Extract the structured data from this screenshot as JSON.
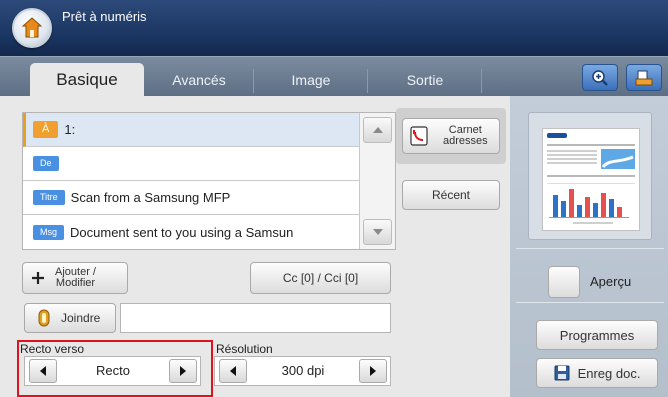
{
  "window": {
    "title": "Prêt à numéris"
  },
  "tabs": [
    {
      "label": "Basique",
      "active": true
    },
    {
      "label": "Avancés",
      "active": false
    },
    {
      "label": "Image",
      "active": false
    },
    {
      "label": "Sortie",
      "active": false
    }
  ],
  "toolbar": {
    "zoom_icon": "zoom-in-icon",
    "job_icon": "job-status-icon"
  },
  "fields": {
    "to": {
      "tag": "À",
      "value": "1:"
    },
    "from": {
      "tag": "De",
      "value": ""
    },
    "subject": {
      "tag": "Titre",
      "value": "Scan from a Samsung MFP"
    },
    "message": {
      "tag": "Msg",
      "value": "Document sent to you using a Samsun"
    }
  },
  "buttons": {
    "add_modify_line1": "Ajouter /",
    "add_modify_line2": "Modifier",
    "cc": "Cc [0] / Cci [0]",
    "attach": "Joindre",
    "addressbook_line1": "Carnet",
    "addressbook_line2": "adresses",
    "recent": "Récent",
    "preview": "Aperçu",
    "programs": "Programmes",
    "save_doc": "Enreg doc."
  },
  "duplex": {
    "label": "Recto verso",
    "value": "Recto"
  },
  "resolution": {
    "label": "Résolution",
    "value": "300 dpi"
  },
  "colors": {
    "accent": "#e8a020",
    "chip": "#4a90e2",
    "titlebar": "#1a3460",
    "highlight": "#e0121e"
  }
}
